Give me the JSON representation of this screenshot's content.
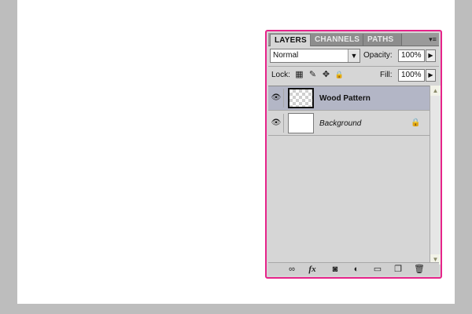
{
  "panel": {
    "tabs": [
      {
        "label": "LAYERS",
        "active": true
      },
      {
        "label": "CHANNELS",
        "active": false
      },
      {
        "label": "PATHS",
        "active": false
      }
    ],
    "menu_icon": "▾≡"
  },
  "controls": {
    "blend_mode": "Normal",
    "opacity_label": "Opacity:",
    "opacity_value": "100%",
    "lock_label": "Lock:",
    "fill_label": "Fill:",
    "fill_value": "100%"
  },
  "layers": [
    {
      "name": "Wood Pattern",
      "visible": true,
      "selected": true,
      "locked": false,
      "thumbnail": "transparent"
    },
    {
      "name": "Background",
      "visible": true,
      "selected": false,
      "locked": true,
      "thumbnail": "white"
    }
  ],
  "icons": {
    "eye": "👁",
    "lock": "🔒",
    "dropdown": "▼",
    "spin": "▶",
    "scroll_up": "▲",
    "scroll_down": "▼",
    "lock_transparent": "▦",
    "lock_paint": "✎",
    "lock_move": "✥",
    "lock_all": "🔒",
    "link": "∞",
    "fx": "fx",
    "mask": "◙",
    "adjustment": "◐",
    "group": "▭",
    "new_layer": "❐",
    "delete": "🗑"
  },
  "colors": {
    "panel_border": "#e6248a",
    "selected_layer": "#b3b6c6"
  }
}
